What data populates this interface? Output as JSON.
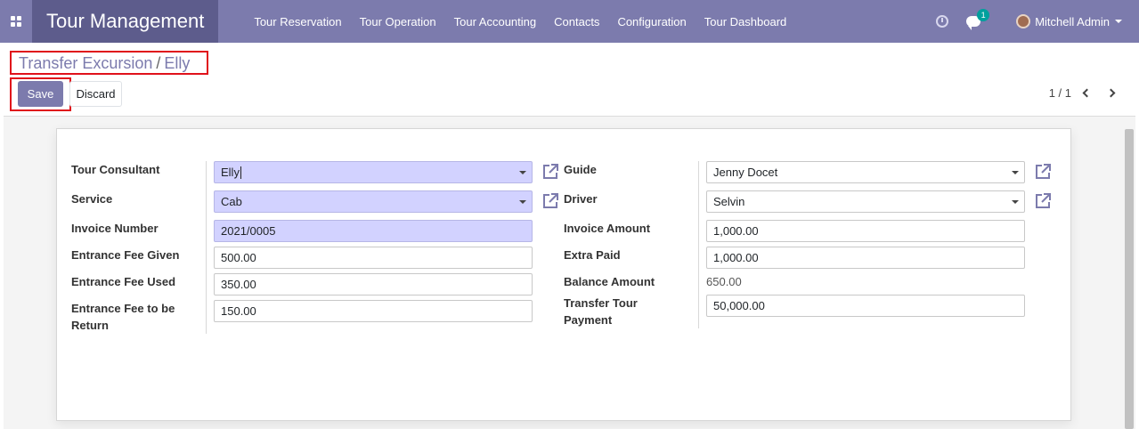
{
  "navbar": {
    "app_name": "Tour Management",
    "menu": [
      "Tour Reservation",
      "Tour Operation",
      "Tour Accounting",
      "Contacts",
      "Configuration",
      "Tour Dashboard"
    ],
    "chat_count": "1",
    "user": "Mitchell Admin"
  },
  "breadcrumb": {
    "parent": "Transfer Excursion",
    "separator": "/",
    "current": "Elly"
  },
  "toolbar": {
    "save_label": "Save",
    "discard_label": "Discard",
    "pager": "1 / 1"
  },
  "form": {
    "left": {
      "tour_consultant": {
        "label": "Tour Consultant",
        "value": "Elly"
      },
      "service": {
        "label": "Service",
        "value": "Cab"
      },
      "invoice_number": {
        "label": "Invoice Number",
        "value": "2021/0005"
      },
      "entrance_fee_given": {
        "label": "Entrance Fee Given",
        "value": "500.00"
      },
      "entrance_fee_used": {
        "label": "Entrance Fee Used",
        "value": "350.00"
      },
      "entrance_fee_return": {
        "label_line1": "Entrance Fee to be",
        "label_line2": "Return",
        "value": "150.00"
      }
    },
    "right": {
      "guide": {
        "label": "Guide",
        "value": "Jenny Docet"
      },
      "driver": {
        "label": "Driver",
        "value": "Selvin"
      },
      "invoice_amount": {
        "label": "Invoice Amount",
        "value": "1,000.00"
      },
      "extra_paid": {
        "label": "Extra Paid",
        "value": "1,000.00"
      },
      "balance_amount": {
        "label": "Balance Amount",
        "value": "650.00"
      },
      "transfer_tour_payment": {
        "label_line1": "Transfer Tour",
        "label_line2": "Payment",
        "value": "50,000.00"
      }
    }
  },
  "colors": {
    "brand": "#7c7bad",
    "brand_dark": "#5d5c8c",
    "required_field": "#d2d2ff",
    "highlight": "#e0121b",
    "badge": "#00a09d"
  },
  "icons": [
    "apps-grid-icon",
    "clock-icon",
    "chat-icon",
    "external-link-icon",
    "chevron-left-icon",
    "chevron-right-icon",
    "caret-down-icon"
  ]
}
